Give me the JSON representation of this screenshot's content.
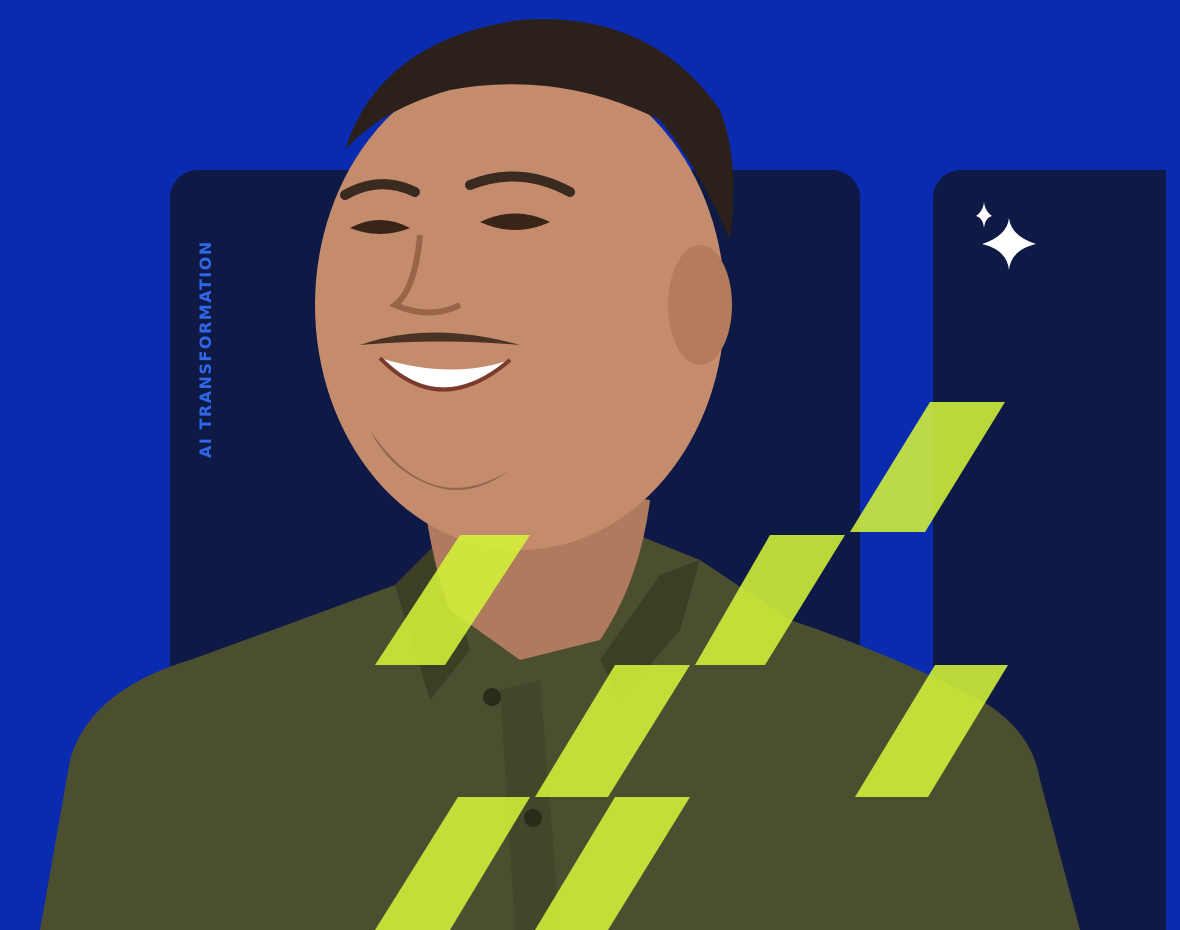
{
  "hero": {
    "label": "AI TRANSFORMATION",
    "sparkle_icon": "sparkle-icon",
    "colors": {
      "background": "#0a2bb0",
      "panel": "#0e1a45",
      "label": "#2f67e8",
      "accent": "#d4f23a",
      "shirt": "#4b4f30"
    }
  }
}
